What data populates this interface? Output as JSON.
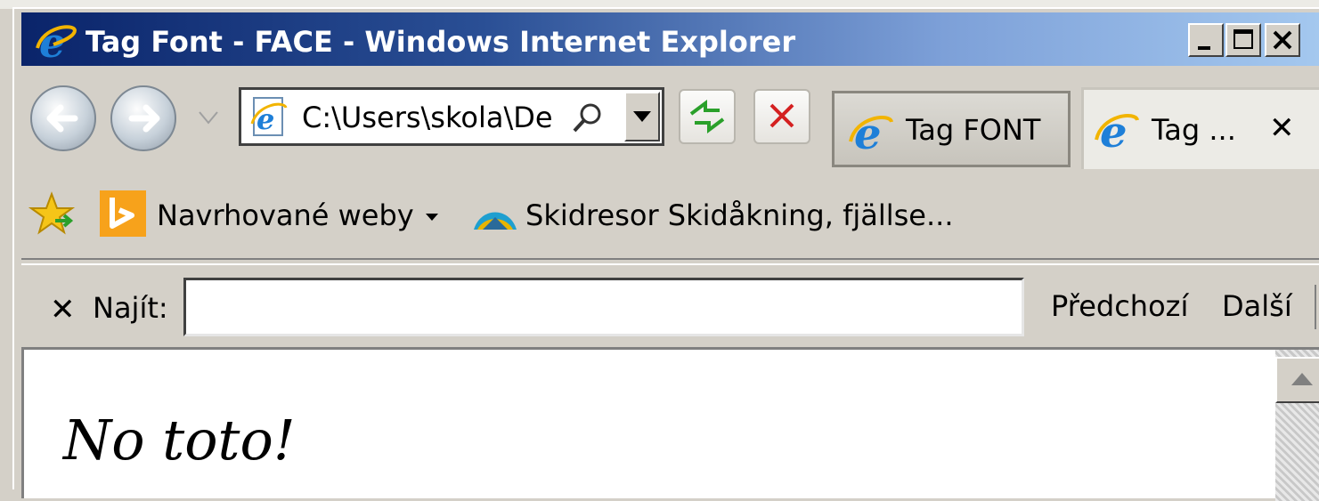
{
  "window": {
    "title": "Tag Font - FACE - Windows Internet Explorer",
    "controls": [
      "minimize",
      "maximize",
      "close"
    ]
  },
  "address_bar": {
    "value": "C:\\Users\\skola\\De:",
    "icon": "ie-page-icon"
  },
  "tabs": [
    {
      "label": "Tag FONT",
      "active": false
    },
    {
      "label": "Tag ...",
      "active": true,
      "close_glyph": "✕"
    }
  ],
  "favorites": {
    "items": [
      {
        "label": "Navrhované weby",
        "icon": "bing-icon",
        "dropdown": true
      },
      {
        "label": "Skidresor Skidåkning, fjällse...",
        "icon": "site-favicon"
      }
    ]
  },
  "find_bar": {
    "close_glyph": "✕",
    "label": "Najít:",
    "value": "",
    "prev_label": "Předchozí",
    "next_label": "Další"
  },
  "content": {
    "heading": "No toto!"
  },
  "colors": {
    "title_gradient_start": "#0a246a",
    "title_gradient_end": "#a6caf0",
    "chrome": "#d4d0c8",
    "stop_red": "#d42020",
    "refresh_green": "#2aa02a"
  }
}
